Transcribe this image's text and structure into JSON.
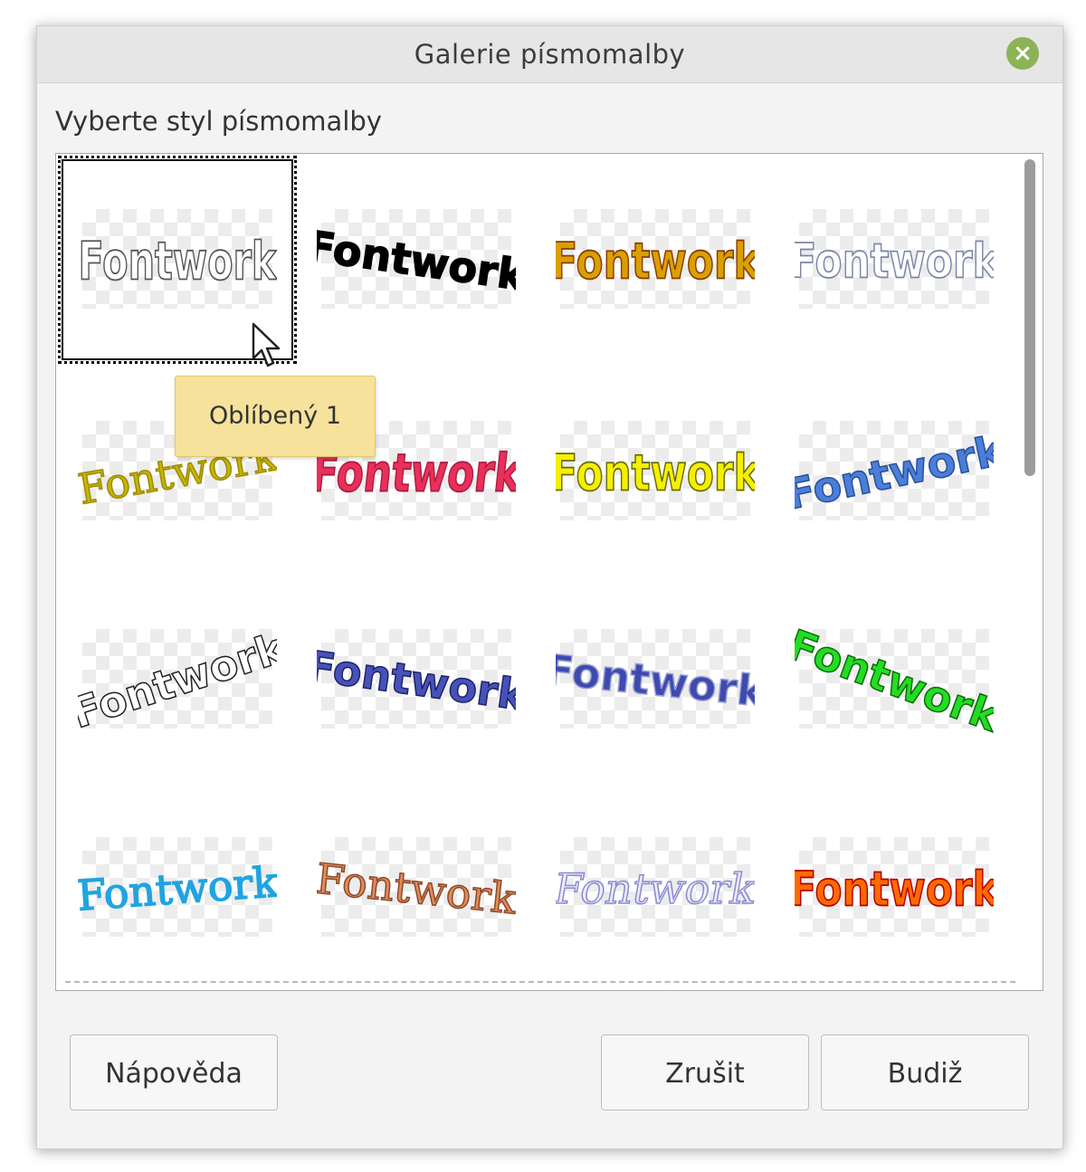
{
  "dialog": {
    "title": "Galerie písmomalby",
    "close_icon": "close-icon",
    "prompt_label": "Vyberte styl písmomalby"
  },
  "gallery": {
    "items": [
      {
        "text": "Fontwork",
        "tooltip": "Oblíbený 1",
        "selected": true,
        "fill": "#ffffff",
        "stroke": "#555555"
      },
      {
        "text": "Fontwork",
        "fill": "#000000",
        "stroke": "#000000"
      },
      {
        "text": "Fontwork",
        "fill": "#d9a000",
        "stroke": "#8a3b00"
      },
      {
        "text": "Fontwork",
        "fill": "#ffffff",
        "stroke": "#7a86a8"
      },
      {
        "text": "Fontwork",
        "fill": "#c9b400",
        "stroke": "#9c8c00"
      },
      {
        "text": "Fontwork",
        "fill": "#e8305a",
        "stroke": "#b01c40"
      },
      {
        "text": "Fontwork",
        "fill": "#f4f000",
        "stroke": "#6b6b00"
      },
      {
        "text": "Fontwork",
        "fill": "#4a7ed9",
        "stroke": "#2a4f99"
      },
      {
        "text": "Fontwork",
        "fill": "#ffffff",
        "stroke": "#222222"
      },
      {
        "text": "Fontwork",
        "fill": "#4752b8",
        "stroke": "#1d226b"
      },
      {
        "text": "Fontwork",
        "fill": "#3f4ab0",
        "stroke": "#9aa0d0"
      },
      {
        "text": "Fontwork",
        "fill": "#23dd23",
        "stroke": "#0b6b0b"
      },
      {
        "text": "Fontwork",
        "fill": "#21a4e0",
        "stroke": "#21a4e0"
      },
      {
        "text": "Fontwork",
        "fill": "#e58a5a",
        "stroke": "#8a4a2a"
      },
      {
        "text": "Fontwork",
        "fill": "#ececff",
        "stroke": "#8a8ad0"
      },
      {
        "text": "Fontwork",
        "fill": "#ff6a00",
        "stroke": "#b30000"
      }
    ],
    "tooltip": "Oblíbený 1"
  },
  "buttons": {
    "help": "Nápověda",
    "cancel": "Zrušit",
    "ok": "Budiž"
  }
}
